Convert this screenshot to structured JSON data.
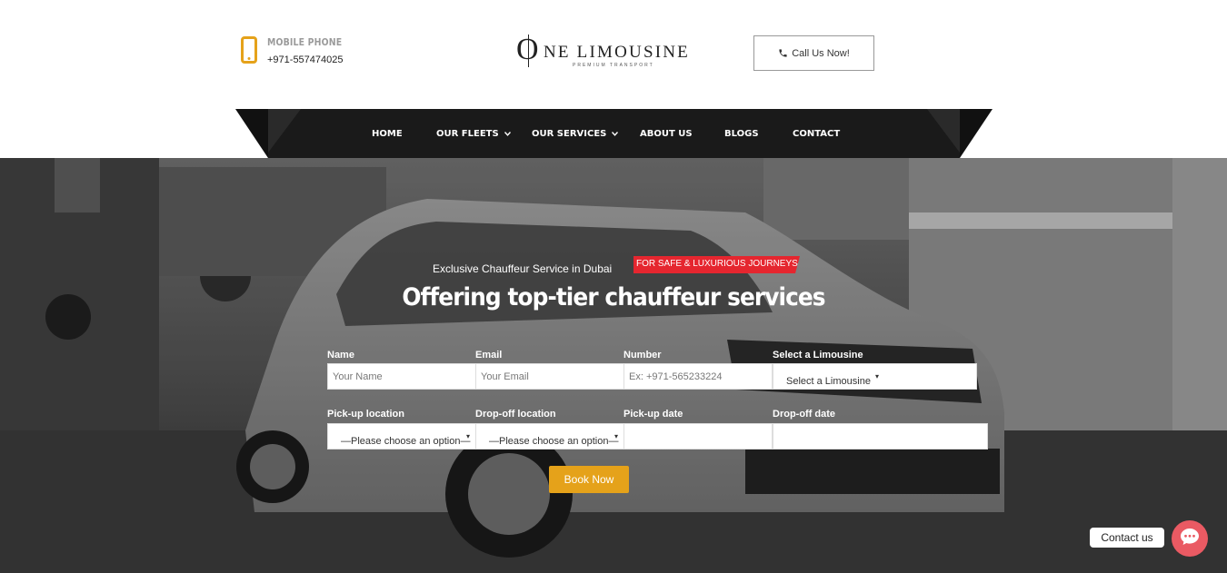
{
  "header": {
    "phone_label": "MOBILE PHONE",
    "phone_number": "+971-557474025",
    "logo_letter": "O",
    "logo_word": "NE LIMOUSINE",
    "logo_tagline": "PREMIUM TRANSPORT",
    "call_button": "Call Us Now!"
  },
  "nav": {
    "items": [
      {
        "label": "HOME"
      },
      {
        "label": "OUR FLEETS"
      },
      {
        "label": "OUR SERVICES"
      },
      {
        "label": "ABOUT US"
      },
      {
        "label": "BLOGS"
      },
      {
        "label": "CONTACT"
      }
    ]
  },
  "hero": {
    "subtitle": "Exclusive Chauffeur Service in Dubai",
    "badge": "FOR SAFE & LUXURIOUS JOURNEYS",
    "headline": "Offering top-tier chauffeur services"
  },
  "form": {
    "name_label": "Name",
    "name_placeholder": "Your Name",
    "email_label": "Email",
    "email_placeholder": "Your Email",
    "number_label": "Number",
    "number_placeholder": "Ex: +971-565233224",
    "limo_label": "Select a Limousine",
    "limo_value": "Select a Limousine",
    "pickup_label": "Pick-up location",
    "pickup_value": "—Please choose an option—",
    "dropoff_label": "Drop-off location",
    "dropoff_value": "—Please choose an option—",
    "pickup_date_label": "Pick-up date",
    "dropoff_date_label": "Drop-off date",
    "submit": "Book Now"
  },
  "chat": {
    "label": "Contact us"
  },
  "colors": {
    "accent": "#e5a21a",
    "badge": "#e5262f",
    "nav_bg": "#1a1a1a",
    "chat": "#ea5a63"
  }
}
